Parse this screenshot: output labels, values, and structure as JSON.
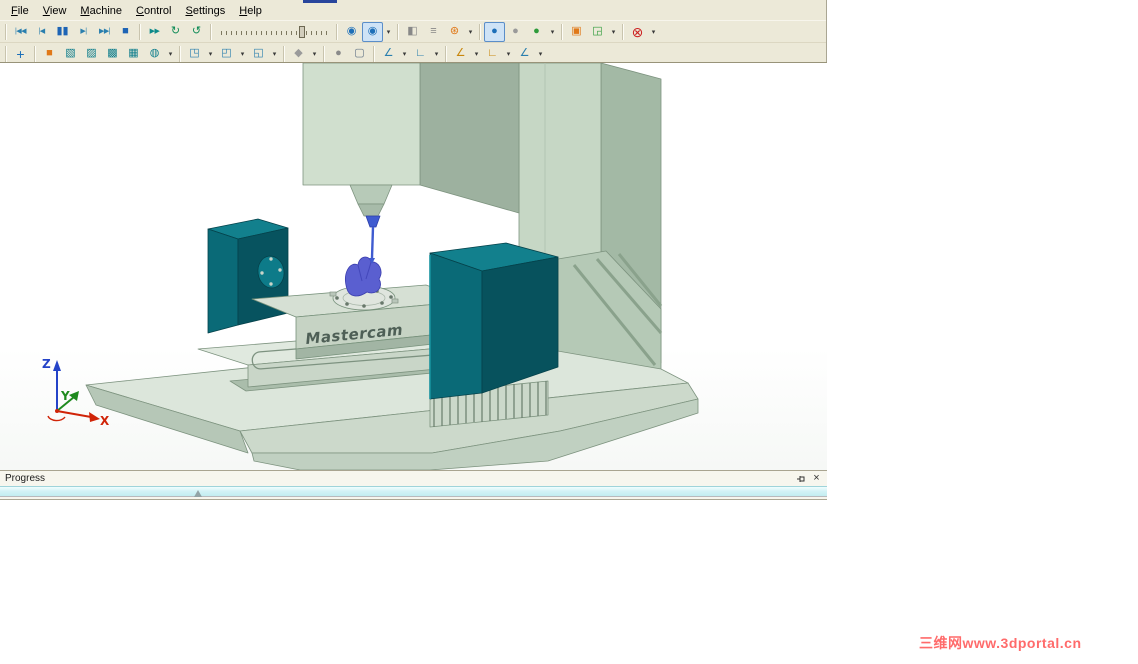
{
  "menu": {
    "items": [
      {
        "name": "menu-file",
        "label": "File"
      },
      {
        "name": "menu-view",
        "label": "View"
      },
      {
        "name": "menu-machine",
        "label": "Machine"
      },
      {
        "name": "menu-control",
        "label": "Control"
      },
      {
        "name": "menu-settings",
        "label": "Settings"
      },
      {
        "name": "menu-help",
        "label": "Help"
      }
    ]
  },
  "toolbar1": {
    "items": [
      {
        "kind": "separator",
        "name": "toolbar1-grip"
      },
      {
        "kind": "button",
        "name": "go-to-start-button",
        "glyph": "|◀◀",
        "color": "#2a7fae",
        "small": true
      },
      {
        "kind": "button",
        "name": "step-back-button",
        "glyph": "|◀",
        "color": "#2a7fae",
        "small": true
      },
      {
        "kind": "button",
        "name": "pause-button",
        "glyph": "▮▮",
        "color": "#1d64b5"
      },
      {
        "kind": "button",
        "name": "step-forward-button",
        "glyph": "▶|",
        "color": "#2a7fae",
        "small": true
      },
      {
        "kind": "button",
        "name": "go-to-end-button",
        "glyph": "▶▶|",
        "color": "#2a7fae",
        "small": true
      },
      {
        "kind": "button",
        "name": "stop-button",
        "glyph": "■",
        "color": "#1d64b5"
      },
      {
        "kind": "separator",
        "name": "playback-separator"
      },
      {
        "kind": "button",
        "name": "play-button",
        "glyph": "▶▶",
        "color": "#0d8a8a",
        "small": true
      },
      {
        "kind": "button",
        "name": "loop-forward-button",
        "glyph": "↻",
        "color": "#0d8a55"
      },
      {
        "kind": "button",
        "name": "loop-back-button",
        "glyph": "↺",
        "color": "#0d8a55"
      },
      {
        "kind": "separator",
        "name": "speed-separator"
      },
      {
        "kind": "slider",
        "name": "speed-slider"
      },
      {
        "kind": "separator",
        "name": "mode-separator"
      },
      {
        "kind": "button",
        "name": "material-removal-toggle-button",
        "glyph": "◉",
        "color": "#1d6fb8"
      },
      {
        "kind": "button",
        "name": "machine-sim-toggle-button",
        "glyph": "◉",
        "color": "#1d6fb8",
        "pressed": true
      },
      {
        "kind": "dropdown",
        "name": "sim-mode-dropdown",
        "glyph": "▾"
      },
      {
        "kind": "separator",
        "name": "tools-separator"
      },
      {
        "kind": "button",
        "name": "section-view-button",
        "glyph": "◧",
        "color": "#888888"
      },
      {
        "kind": "button",
        "name": "report-button",
        "glyph": "≡",
        "color": "#888888"
      },
      {
        "kind": "button",
        "name": "options-gears-button",
        "glyph": "⊛",
        "color": "#e07818"
      },
      {
        "kind": "dropdown",
        "name": "options-dropdown",
        "glyph": "▾"
      },
      {
        "kind": "separator",
        "name": "visibility-separator"
      },
      {
        "kind": "button",
        "name": "machine-visibility-button",
        "glyph": "●",
        "color": "#1d6fb8",
        "pressed": true
      },
      {
        "kind": "button",
        "name": "fixture-visibility-button",
        "glyph": "●",
        "color": "#9a9a9a"
      },
      {
        "kind": "button",
        "name": "world-view-button",
        "glyph": "●",
        "color": "#2e9b3a"
      },
      {
        "kind": "dropdown",
        "name": "visibility-dropdown",
        "glyph": "▾"
      },
      {
        "kind": "separator",
        "name": "zoom-separator"
      },
      {
        "kind": "button",
        "name": "fit-screen-button",
        "glyph": "▣",
        "color": "#e07818"
      },
      {
        "kind": "button",
        "name": "zoom-extents-button",
        "glyph": "◲",
        "color": "#2e9b3a"
      },
      {
        "kind": "dropdown",
        "name": "zoom-dropdown",
        "glyph": "▾"
      },
      {
        "kind": "separator",
        "name": "close-separator"
      },
      {
        "kind": "button",
        "name": "close-simulation-button",
        "glyph": "⊗",
        "color": "#cc1f1f",
        "big": true
      },
      {
        "kind": "dropdown",
        "name": "close-dropdown",
        "glyph": "▾"
      }
    ]
  },
  "toolbar2": {
    "items": [
      {
        "kind": "separator",
        "name": "toolbar2-grip"
      },
      {
        "kind": "button",
        "name": "jog-axes-button",
        "glyph": "+",
        "color": "#1d6fb8",
        "big": true
      },
      {
        "kind": "separator",
        "name": "views-separator"
      },
      {
        "kind": "button",
        "name": "stock-cube-button",
        "glyph": "■",
        "color": "#e07818"
      },
      {
        "kind": "button",
        "name": "iso-view-cube-button",
        "glyph": "▧",
        "color": "#0d7d8c"
      },
      {
        "kind": "button",
        "name": "front-view-cube-button",
        "glyph": "▨",
        "color": "#0d7d8c"
      },
      {
        "kind": "button",
        "name": "right-view-cube-button",
        "glyph": "▩",
        "color": "#0d7d8c"
      },
      {
        "kind": "button",
        "name": "top-view-cube-button",
        "glyph": "▦",
        "color": "#0d7d8c"
      },
      {
        "kind": "button",
        "name": "turn-view-button",
        "glyph": "◍",
        "color": "#0d7d8c"
      },
      {
        "kind": "dropdown",
        "name": "views-dropdown",
        "glyph": "▾"
      },
      {
        "kind": "separator",
        "name": "focus-separator"
      },
      {
        "kind": "button",
        "name": "follow-tool-button",
        "glyph": "◳",
        "color": "#2a7fae"
      },
      {
        "kind": "dropdown",
        "name": "follow-tool-dropdown",
        "glyph": "▾"
      },
      {
        "kind": "button",
        "name": "workpiece-focus-button",
        "glyph": "◰",
        "color": "#2a7fae"
      },
      {
        "kind": "dropdown",
        "name": "workpiece-focus-dropdown",
        "glyph": "▾"
      },
      {
        "kind": "button",
        "name": "machine-focus-button",
        "glyph": "◱",
        "color": "#2a7fae"
      },
      {
        "kind": "dropdown",
        "name": "machine-focus-dropdown",
        "glyph": "▾"
      },
      {
        "kind": "separator",
        "name": "collision-separator"
      },
      {
        "kind": "button",
        "name": "collision-check-button",
        "glyph": "◆",
        "color": "#9a9a9a"
      },
      {
        "kind": "dropdown",
        "name": "collision-dropdown",
        "glyph": "▾"
      },
      {
        "kind": "separator",
        "name": "display-separator"
      },
      {
        "kind": "button",
        "name": "sphere-display-button",
        "glyph": "●",
        "color": "#8a8a8a"
      },
      {
        "kind": "button",
        "name": "box-display-button",
        "glyph": "▢",
        "color": "#667788"
      },
      {
        "kind": "separator",
        "name": "measure-separator"
      },
      {
        "kind": "button",
        "name": "measure-angle-button",
        "glyph": "∠",
        "color": "#2a7fae"
      },
      {
        "kind": "dropdown",
        "name": "measure-angle-dropdown",
        "glyph": "▾"
      },
      {
        "kind": "button",
        "name": "measure-corner-button",
        "glyph": "∟",
        "color": "#2a7fae"
      },
      {
        "kind": "dropdown",
        "name": "measure-corner-dropdown",
        "glyph": "▾"
      },
      {
        "kind": "separator",
        "name": "rotary-separator"
      },
      {
        "kind": "button",
        "name": "axis-a-angle-button",
        "glyph": "∠",
        "color": "#c8860d"
      },
      {
        "kind": "dropdown",
        "name": "axis-a-dropdown",
        "glyph": "▾"
      },
      {
        "kind": "button",
        "name": "axis-b-angle-button",
        "glyph": "∟",
        "color": "#c8860d"
      },
      {
        "kind": "dropdown",
        "name": "axis-b-dropdown",
        "glyph": "▾"
      },
      {
        "kind": "button",
        "name": "axis-c-angle-button",
        "glyph": "∠",
        "color": "#2a7fae"
      },
      {
        "kind": "dropdown",
        "name": "axis-c-dropdown",
        "glyph": "▾"
      }
    ]
  },
  "viewport": {
    "brand_label": "Mastercam",
    "axis_labels": {
      "x": "X",
      "y": "Y",
      "z": "Z"
    },
    "axis_colors": {
      "x": "#d02408",
      "y": "#1e8a1e",
      "z": "#2443c8"
    }
  },
  "progress": {
    "title": "Progress",
    "percent": 24,
    "icons": {
      "close": "×"
    }
  },
  "watermark": {
    "text": "三维网www.3dportal.cn",
    "color": "#ff6b6b"
  }
}
